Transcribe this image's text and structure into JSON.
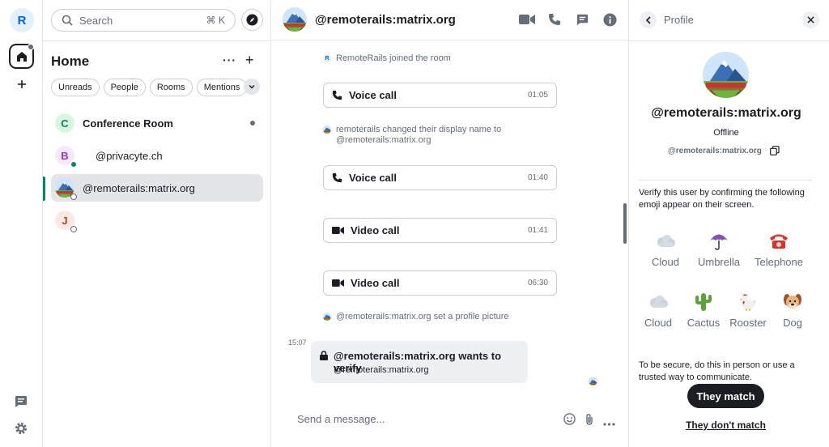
{
  "spaces": {
    "user_initial": "R",
    "home_icon": "home-icon",
    "add_icon": "plus-icon",
    "threads_icon": "threads-icon",
    "settings_icon": "gear-icon"
  },
  "roomlist": {
    "search_label": "Search",
    "search_shortcut": "⌘ K",
    "title": "Home",
    "more": "···",
    "add": "+",
    "filters": [
      "Unreads",
      "People",
      "Rooms",
      "Mentions"
    ],
    "rooms": [
      {
        "initial": "C",
        "name": "Conference Room",
        "bold": true,
        "unread": true,
        "color": "#daf4e3",
        "fg": "#0b8363"
      },
      {
        "initial": "B",
        "name": "@privacyte.ch",
        "bold": false,
        "presence": "online",
        "color": "#f6e9fc",
        "fg": "#9f36c7"
      },
      {
        "initial": "",
        "name": "@remoterails:matrix.org",
        "bold": false,
        "selected": true,
        "presence": "offline"
      },
      {
        "initial": "J",
        "name": "",
        "bold": false,
        "presence": "offline",
        "color": "#fde8e4",
        "fg": "#c3401c"
      }
    ]
  },
  "timeline": {
    "title": "@remoterails:matrix.org",
    "events": {
      "joined": "RemoteRails joined the room",
      "name_change_1": "remoterails changed their display name to",
      "name_change_2": "@remoterails:matrix.org",
      "profile_pic": "@remoterails:matrix.org set a profile picture"
    },
    "calls": [
      {
        "label": "Voice call",
        "time": "01:05",
        "kind": "voice"
      },
      {
        "label": "Voice call",
        "time": "01:40",
        "kind": "voice"
      },
      {
        "label": "Video call",
        "time": "01:41",
        "kind": "video"
      },
      {
        "label": "Video call",
        "time": "06:30",
        "kind": "video"
      }
    ],
    "verify": {
      "timestamp": "15:07",
      "title": "@remoterails:matrix.org wants to verify",
      "subtitle": "@remoterails:matrix.org"
    },
    "composer_placeholder": "Send a message..."
  },
  "profile": {
    "header": "Profile",
    "name": "@remoterails:matrix.org",
    "status": "Offline",
    "mxid": "@remoterails:matrix.org",
    "verify_desc": "Verify this user by confirming the following emoji appear on their screen.",
    "emojis": [
      {
        "name": "Cloud",
        "glyph": "cloud"
      },
      {
        "name": "Umbrella",
        "glyph": "umbrella"
      },
      {
        "name": "Telephone",
        "glyph": "telephone"
      },
      {
        "name": "Cloud",
        "glyph": "cloud"
      },
      {
        "name": "Cactus",
        "glyph": "cactus"
      },
      {
        "name": "Rooster",
        "glyph": "rooster"
      },
      {
        "name": "Dog",
        "glyph": "dog"
      }
    ],
    "secure_text": "To be secure, do this in person or use a trusted way to communicate.",
    "match_label": "They match",
    "nomatch_label": "They don't match"
  },
  "colors": {
    "accent": "#0b8363",
    "text": "#1b1d22",
    "secondary": "#656d77"
  }
}
